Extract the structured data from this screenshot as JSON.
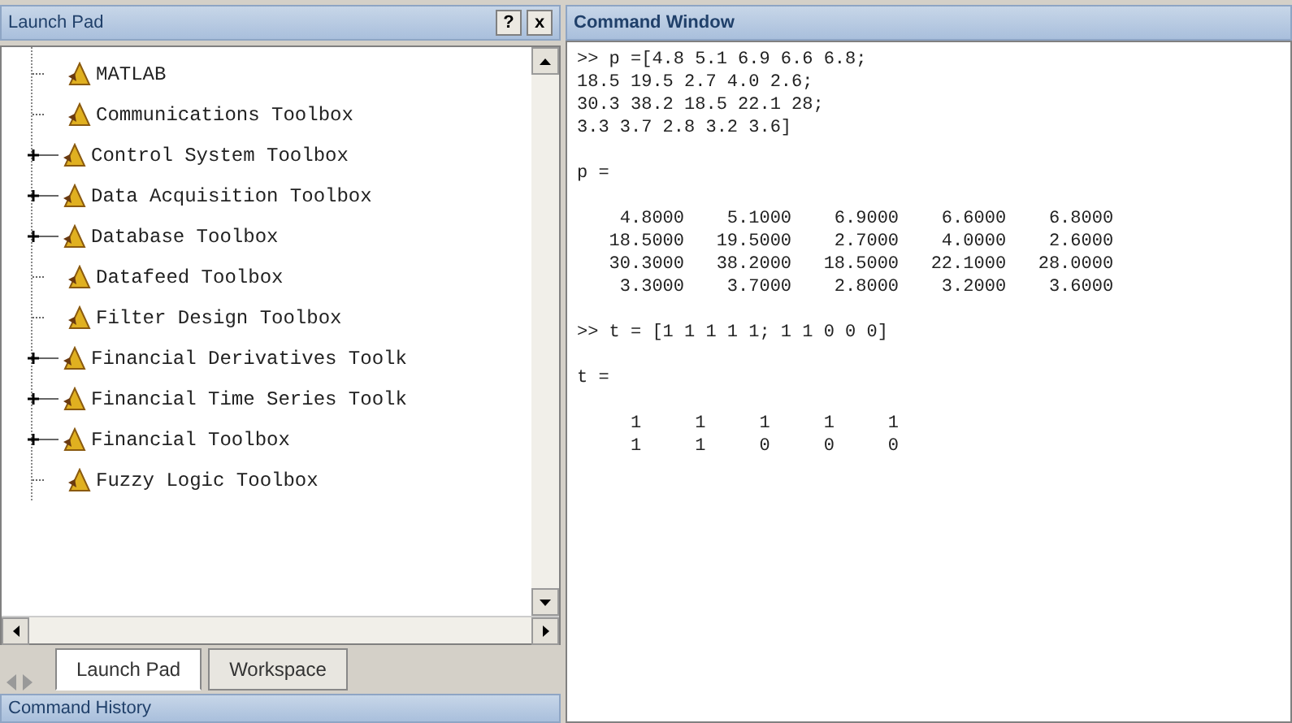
{
  "launch_pad": {
    "title": "Launch Pad",
    "pin_button": "?",
    "close_button": "x",
    "items": [
      {
        "label": "MATLAB",
        "expandable": false
      },
      {
        "label": "Communications Toolbox",
        "expandable": false
      },
      {
        "label": "Control System Toolbox",
        "expandable": true
      },
      {
        "label": "Data Acquisition Toolbox",
        "expandable": true
      },
      {
        "label": "Database Toolbox",
        "expandable": true
      },
      {
        "label": "Datafeed Toolbox",
        "expandable": false
      },
      {
        "label": "Filter Design Toolbox",
        "expandable": false
      },
      {
        "label": "Financial Derivatives Toolk",
        "expandable": true
      },
      {
        "label": "Financial Time Series Toolk",
        "expandable": true
      },
      {
        "label": "Financial Toolbox",
        "expandable": true
      },
      {
        "label": "Fuzzy Logic Toolbox",
        "expandable": false
      }
    ],
    "tabs": [
      {
        "label": "Launch Pad",
        "selected": true
      },
      {
        "label": "Workspace",
        "selected": false
      }
    ]
  },
  "command_history": {
    "title": "Command History"
  },
  "command_window": {
    "title": "Command Window",
    "blocks": [
      [
        ">> p =[4.8 5.1 6.9 6.6 6.8;",
        "18.5 19.5 2.7 4.0 2.6;",
        "30.3 38.2 18.5 22.1 28;",
        "3.3 3.7 2.8 3.2 3.6]"
      ],
      [
        "p ="
      ],
      [
        "    4.8000    5.1000    6.9000    6.6000    6.8000",
        "   18.5000   19.5000    2.7000    4.0000    2.6000",
        "   30.3000   38.2000   18.5000   22.1000   28.0000",
        "    3.3000    3.7000    2.8000    3.2000    3.6000"
      ],
      [
        ">> t = [1 1 1 1 1; 1 1 0 0 0]"
      ],
      [
        "t ="
      ],
      [
        "     1     1     1     1     1",
        "     1     1     0     0     0"
      ]
    ]
  }
}
